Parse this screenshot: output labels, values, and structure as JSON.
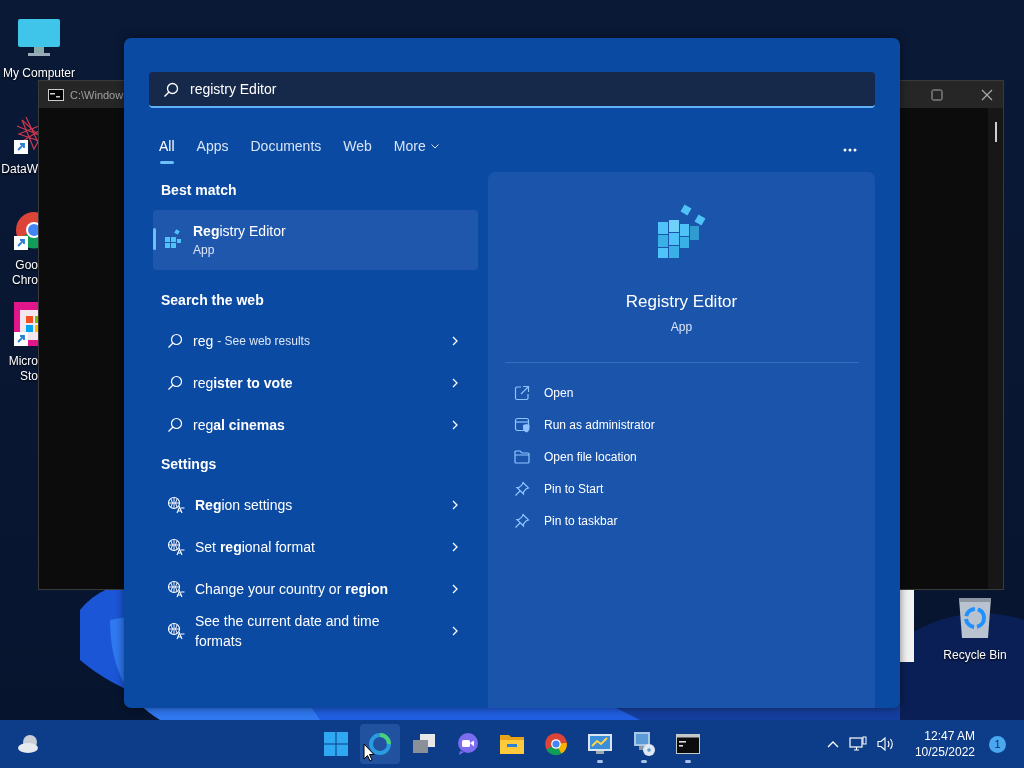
{
  "desktop_icons": [
    {
      "label_lines": [
        "My Computer"
      ],
      "kind": "computer",
      "shortcut": false,
      "cut_by_window": false
    },
    {
      "label_lines": [
        "DataW"
      ],
      "kind": "web",
      "shortcut": true,
      "cut_by_window": true
    },
    {
      "label_lines": [
        "Goo",
        "Chro"
      ],
      "kind": "chrome",
      "shortcut": true,
      "cut_by_window": true
    },
    {
      "label_lines": [
        "Micro",
        "Sto"
      ],
      "kind": "store",
      "shortcut": true,
      "cut_by_window": true
    }
  ],
  "recycle_bin": {
    "label": "Recycle Bin"
  },
  "console_window": {
    "title": "C:\\Window"
  },
  "search": {
    "query": "registry Editor",
    "tabs": [
      {
        "label": "All",
        "selected": true,
        "dropdown": false
      },
      {
        "label": "Apps",
        "selected": false,
        "dropdown": false
      },
      {
        "label": "Documents",
        "selected": false,
        "dropdown": false
      },
      {
        "label": "Web",
        "selected": false,
        "dropdown": false
      },
      {
        "label": "More",
        "selected": false,
        "dropdown": true
      }
    ],
    "best_match": {
      "heading": "Best match",
      "title": "**Reg**istry Editor",
      "subtitle": "App",
      "selected": true
    },
    "web": {
      "heading": "Search the web",
      "items": [
        {
          "text": "reg",
          "suffix": "- See web results"
        },
        {
          "text": "reg**ister to vote**"
        },
        {
          "text": "reg**al cinemas**"
        }
      ]
    },
    "settings": {
      "heading": "Settings",
      "items": [
        {
          "text": "**Reg**ion settings"
        },
        {
          "text": "Set **reg**ional format"
        },
        {
          "text": "Change your country or **region**"
        },
        {
          "text": "See the current date and time formats"
        }
      ]
    },
    "preview": {
      "title": "Registry Editor",
      "subtitle": "App",
      "actions": [
        {
          "label": "Open",
          "kind": "open"
        },
        {
          "label": "Run as administrator",
          "kind": "admin"
        },
        {
          "label": "Open file location",
          "kind": "folder"
        },
        {
          "label": "Pin to Start",
          "kind": "pin"
        },
        {
          "label": "Pin to taskbar",
          "kind": "pin"
        }
      ]
    }
  },
  "taskbar": {
    "apps": [
      {
        "kind": "start",
        "running": false,
        "hovered": false
      },
      {
        "kind": "ring",
        "running": false,
        "hovered": true
      },
      {
        "kind": "taskview",
        "running": false,
        "hovered": false
      },
      {
        "kind": "chat",
        "running": false,
        "hovered": false
      },
      {
        "kind": "explorer",
        "running": false,
        "hovered": false
      },
      {
        "kind": "chrome",
        "running": false,
        "hovered": false
      },
      {
        "kind": "control",
        "running": true,
        "hovered": false
      },
      {
        "kind": "disc",
        "running": true,
        "hovered": false
      },
      {
        "kind": "terminal",
        "running": true,
        "hovered": false
      }
    ],
    "clock": {
      "time": "12:47 AM",
      "date": "10/25/2022"
    },
    "notifications": "1"
  }
}
